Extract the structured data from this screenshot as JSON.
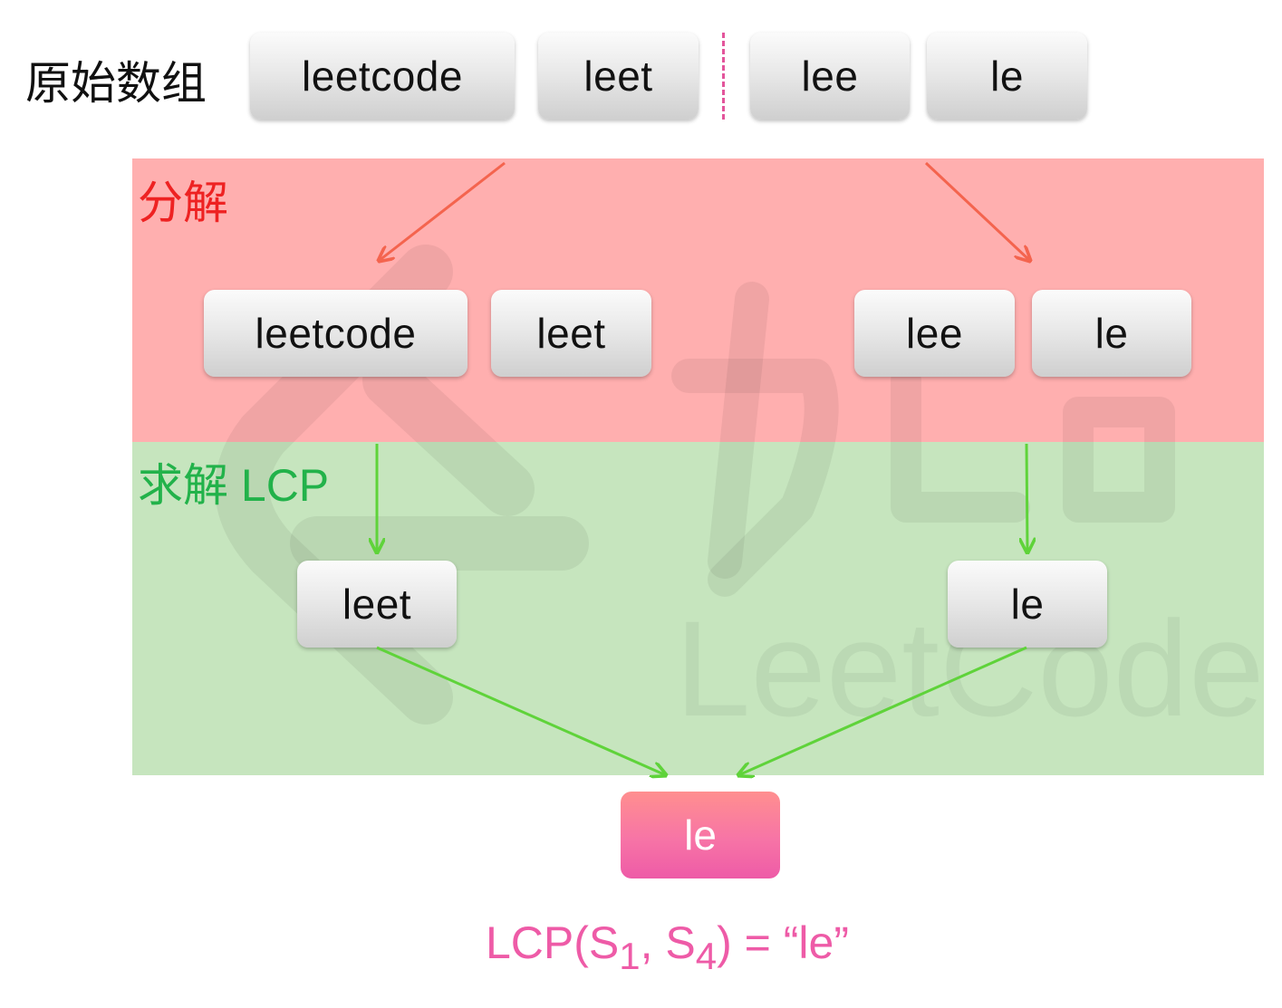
{
  "labels": {
    "original": "原始数组",
    "divide": "分解",
    "solve": "求解 LCP"
  },
  "original_array": [
    "leetcode",
    "leet",
    "lee",
    "le"
  ],
  "divide_level": {
    "left": [
      "leetcode",
      "leet"
    ],
    "right": [
      "lee",
      "le"
    ]
  },
  "solve_level": {
    "left": "leet",
    "right": "le"
  },
  "result": "le",
  "formula": {
    "prefix": "LCP(S",
    "sub1": "1",
    "sep": ", S",
    "sub2": "4",
    "suffix": ")  = “le”"
  },
  "colors": {
    "divide_band": "#ffafaf",
    "solve_band": "#c6e5be",
    "divide_text": "#ee2222",
    "solve_text": "#22b24a",
    "divide_arrow": "#f4644e",
    "solve_arrow": "#5fd33a",
    "result_pink": "#ee5ba7"
  }
}
